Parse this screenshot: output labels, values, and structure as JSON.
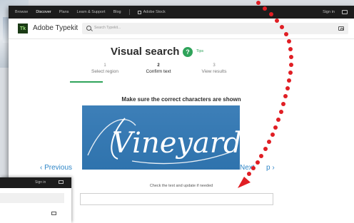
{
  "topbar": {
    "nav": [
      "Browse",
      "Discover",
      "Plans",
      "Learn & Support",
      "Blog"
    ],
    "active": "Discover",
    "stock_label": "Adobe Stock",
    "signin": "Sign in"
  },
  "header": {
    "logo_text": "Tk",
    "brand": "Adobe Typekit",
    "search_placeholder": "Search Typekit..."
  },
  "visual_search": {
    "title": "Visual search",
    "help_symbol": "?",
    "tips": "Tips",
    "steps": [
      {
        "num": "1",
        "label": "Select region",
        "active": false
      },
      {
        "num": "2",
        "label": "Confirm text",
        "active": true
      },
      {
        "num": "3",
        "label": "View results",
        "active": false
      }
    ],
    "subtitle": "Make sure the correct characters are shown",
    "image_word": "Vineyard",
    "previous": "‹ Previous",
    "next": "Next",
    "next_tail": "p ›",
    "hint": "Check the text and update if needed",
    "text_value": ""
  },
  "second_window": {
    "signin": "Sign in"
  },
  "colors": {
    "accent_green": "#2fa35a",
    "link_blue": "#2f86c7",
    "arrow_red": "#e01e24",
    "image_blue": "#3d7fb8"
  }
}
